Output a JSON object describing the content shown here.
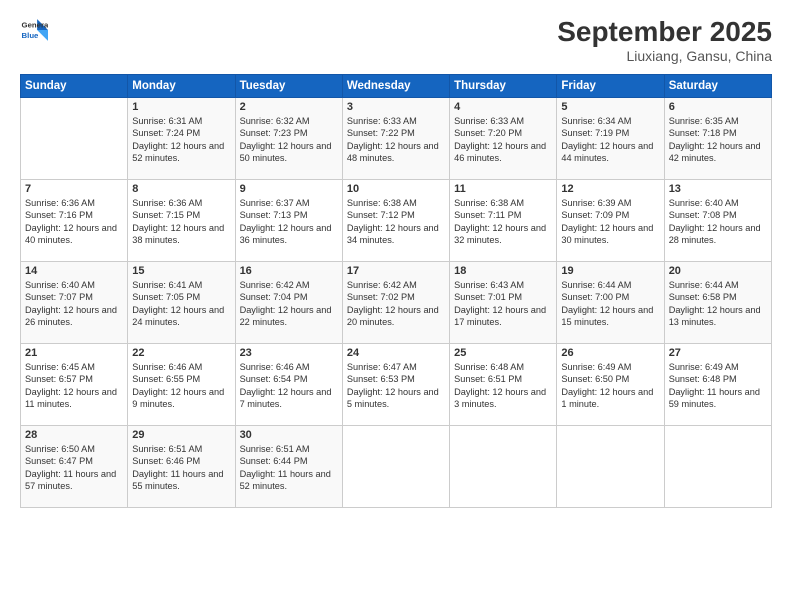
{
  "header": {
    "logo": {
      "general": "General",
      "blue": "Blue"
    },
    "title": "September 2025",
    "location": "Liuxiang, Gansu, China"
  },
  "weekdays": [
    "Sunday",
    "Monday",
    "Tuesday",
    "Wednesday",
    "Thursday",
    "Friday",
    "Saturday"
  ],
  "weeks": [
    [
      {
        "day": "",
        "sunrise": "",
        "sunset": "",
        "daylight": ""
      },
      {
        "day": "1",
        "sunrise": "Sunrise: 6:31 AM",
        "sunset": "Sunset: 7:24 PM",
        "daylight": "Daylight: 12 hours and 52 minutes."
      },
      {
        "day": "2",
        "sunrise": "Sunrise: 6:32 AM",
        "sunset": "Sunset: 7:23 PM",
        "daylight": "Daylight: 12 hours and 50 minutes."
      },
      {
        "day": "3",
        "sunrise": "Sunrise: 6:33 AM",
        "sunset": "Sunset: 7:22 PM",
        "daylight": "Daylight: 12 hours and 48 minutes."
      },
      {
        "day": "4",
        "sunrise": "Sunrise: 6:33 AM",
        "sunset": "Sunset: 7:20 PM",
        "daylight": "Daylight: 12 hours and 46 minutes."
      },
      {
        "day": "5",
        "sunrise": "Sunrise: 6:34 AM",
        "sunset": "Sunset: 7:19 PM",
        "daylight": "Daylight: 12 hours and 44 minutes."
      },
      {
        "day": "6",
        "sunrise": "Sunrise: 6:35 AM",
        "sunset": "Sunset: 7:18 PM",
        "daylight": "Daylight: 12 hours and 42 minutes."
      }
    ],
    [
      {
        "day": "7",
        "sunrise": "Sunrise: 6:36 AM",
        "sunset": "Sunset: 7:16 PM",
        "daylight": "Daylight: 12 hours and 40 minutes."
      },
      {
        "day": "8",
        "sunrise": "Sunrise: 6:36 AM",
        "sunset": "Sunset: 7:15 PM",
        "daylight": "Daylight: 12 hours and 38 minutes."
      },
      {
        "day": "9",
        "sunrise": "Sunrise: 6:37 AM",
        "sunset": "Sunset: 7:13 PM",
        "daylight": "Daylight: 12 hours and 36 minutes."
      },
      {
        "day": "10",
        "sunrise": "Sunrise: 6:38 AM",
        "sunset": "Sunset: 7:12 PM",
        "daylight": "Daylight: 12 hours and 34 minutes."
      },
      {
        "day": "11",
        "sunrise": "Sunrise: 6:38 AM",
        "sunset": "Sunset: 7:11 PM",
        "daylight": "Daylight: 12 hours and 32 minutes."
      },
      {
        "day": "12",
        "sunrise": "Sunrise: 6:39 AM",
        "sunset": "Sunset: 7:09 PM",
        "daylight": "Daylight: 12 hours and 30 minutes."
      },
      {
        "day": "13",
        "sunrise": "Sunrise: 6:40 AM",
        "sunset": "Sunset: 7:08 PM",
        "daylight": "Daylight: 12 hours and 28 minutes."
      }
    ],
    [
      {
        "day": "14",
        "sunrise": "Sunrise: 6:40 AM",
        "sunset": "Sunset: 7:07 PM",
        "daylight": "Daylight: 12 hours and 26 minutes."
      },
      {
        "day": "15",
        "sunrise": "Sunrise: 6:41 AM",
        "sunset": "Sunset: 7:05 PM",
        "daylight": "Daylight: 12 hours and 24 minutes."
      },
      {
        "day": "16",
        "sunrise": "Sunrise: 6:42 AM",
        "sunset": "Sunset: 7:04 PM",
        "daylight": "Daylight: 12 hours and 22 minutes."
      },
      {
        "day": "17",
        "sunrise": "Sunrise: 6:42 AM",
        "sunset": "Sunset: 7:02 PM",
        "daylight": "Daylight: 12 hours and 20 minutes."
      },
      {
        "day": "18",
        "sunrise": "Sunrise: 6:43 AM",
        "sunset": "Sunset: 7:01 PM",
        "daylight": "Daylight: 12 hours and 17 minutes."
      },
      {
        "day": "19",
        "sunrise": "Sunrise: 6:44 AM",
        "sunset": "Sunset: 7:00 PM",
        "daylight": "Daylight: 12 hours and 15 minutes."
      },
      {
        "day": "20",
        "sunrise": "Sunrise: 6:44 AM",
        "sunset": "Sunset: 6:58 PM",
        "daylight": "Daylight: 12 hours and 13 minutes."
      }
    ],
    [
      {
        "day": "21",
        "sunrise": "Sunrise: 6:45 AM",
        "sunset": "Sunset: 6:57 PM",
        "daylight": "Daylight: 12 hours and 11 minutes."
      },
      {
        "day": "22",
        "sunrise": "Sunrise: 6:46 AM",
        "sunset": "Sunset: 6:55 PM",
        "daylight": "Daylight: 12 hours and 9 minutes."
      },
      {
        "day": "23",
        "sunrise": "Sunrise: 6:46 AM",
        "sunset": "Sunset: 6:54 PM",
        "daylight": "Daylight: 12 hours and 7 minutes."
      },
      {
        "day": "24",
        "sunrise": "Sunrise: 6:47 AM",
        "sunset": "Sunset: 6:53 PM",
        "daylight": "Daylight: 12 hours and 5 minutes."
      },
      {
        "day": "25",
        "sunrise": "Sunrise: 6:48 AM",
        "sunset": "Sunset: 6:51 PM",
        "daylight": "Daylight: 12 hours and 3 minutes."
      },
      {
        "day": "26",
        "sunrise": "Sunrise: 6:49 AM",
        "sunset": "Sunset: 6:50 PM",
        "daylight": "Daylight: 12 hours and 1 minute."
      },
      {
        "day": "27",
        "sunrise": "Sunrise: 6:49 AM",
        "sunset": "Sunset: 6:48 PM",
        "daylight": "Daylight: 11 hours and 59 minutes."
      }
    ],
    [
      {
        "day": "28",
        "sunrise": "Sunrise: 6:50 AM",
        "sunset": "Sunset: 6:47 PM",
        "daylight": "Daylight: 11 hours and 57 minutes."
      },
      {
        "day": "29",
        "sunrise": "Sunrise: 6:51 AM",
        "sunset": "Sunset: 6:46 PM",
        "daylight": "Daylight: 11 hours and 55 minutes."
      },
      {
        "day": "30",
        "sunrise": "Sunrise: 6:51 AM",
        "sunset": "Sunset: 6:44 PM",
        "daylight": "Daylight: 11 hours and 52 minutes."
      },
      {
        "day": "",
        "sunrise": "",
        "sunset": "",
        "daylight": ""
      },
      {
        "day": "",
        "sunrise": "",
        "sunset": "",
        "daylight": ""
      },
      {
        "day": "",
        "sunrise": "",
        "sunset": "",
        "daylight": ""
      },
      {
        "day": "",
        "sunrise": "",
        "sunset": "",
        "daylight": ""
      }
    ]
  ]
}
